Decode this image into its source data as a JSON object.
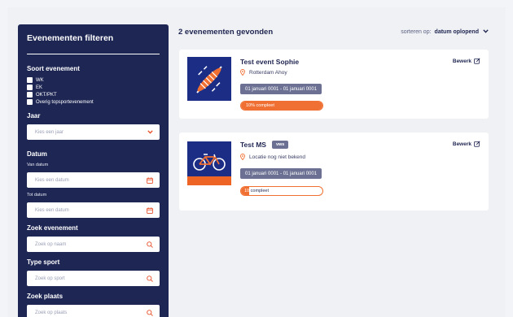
{
  "sidebar": {
    "title": "Evenementen filteren",
    "type_heading": "Soort evenement",
    "types": [
      "WK",
      "EK",
      "OKT/PKT",
      "Overig topsportevenement"
    ],
    "year_heading": "Jaar",
    "year_placeholder": "Kies een jaar",
    "date_heading": "Datum",
    "from_label": "Van datum",
    "from_placeholder": "Kies een datum",
    "to_label": "Tot datum",
    "to_placeholder": "Kies een datum",
    "event_heading": "Zoek evenement",
    "event_placeholder": "Zoek op naam",
    "sport_heading": "Type sport",
    "sport_placeholder": "Zoek op sport",
    "place_heading": "Zoek plaats",
    "place_placeholder": "Zoek op plaats"
  },
  "results": {
    "count_text": "2 evenementen gevonden",
    "sort_label": "sorteren op:",
    "sort_value": "datum oplopend"
  },
  "events": [
    {
      "title": "Test event Sophie",
      "badge": "",
      "location": "Rotterdam Ahoy",
      "dates": "01 januari 0001 - 01 januari 0001",
      "progress_text": "10% compleet",
      "progress_value": 1.0,
      "edit_label": "Bewerk",
      "icon": "rowing-icon"
    },
    {
      "title": "Test MS",
      "badge": "vws",
      "location": "Locatie nog niet bekend",
      "dates": "01 januari 0001 - 01 januari 0001",
      "progress_prefix": "10",
      "progress_text": "compleet",
      "progress_value": 0.1,
      "edit_label": "Bewerk",
      "icon": "cycling-icon"
    }
  ],
  "colors": {
    "navy": "#1e2654",
    "accent": "#f07033",
    "badge": "#6c7193",
    "thumb_blue": "#1c2d86"
  }
}
